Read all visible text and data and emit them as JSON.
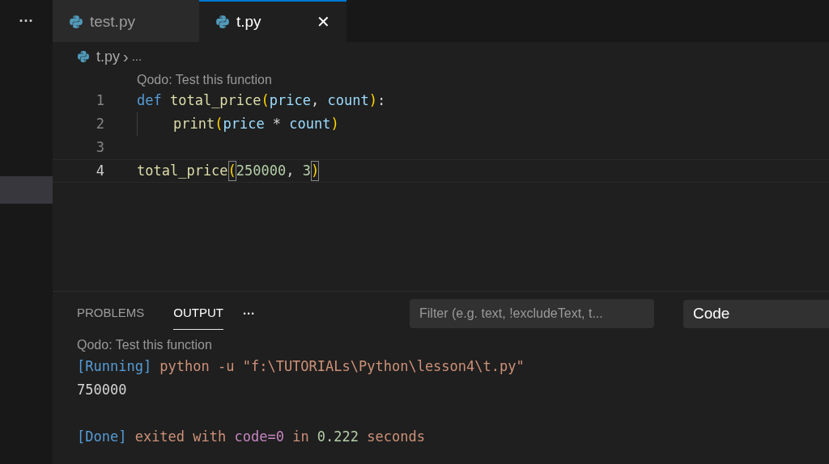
{
  "sidebar": {
    "more": "···",
    "rows": [
      {
        "selected": true
      }
    ]
  },
  "tabs": [
    {
      "label": "test.py",
      "selected": false
    },
    {
      "label": "t.py",
      "selected": true,
      "close": "✕"
    }
  ],
  "breadcrumb": {
    "file": "t.py",
    "separator": "›",
    "rest": "..."
  },
  "editor": {
    "codelens": "Qodo: Test this function",
    "lines": [
      {
        "number": "1",
        "active": false,
        "tokens": [
          {
            "text": "def ",
            "kind": "keyword"
          },
          {
            "text": "total_price",
            "kind": "function"
          },
          {
            "text": "(",
            "kind": "bracket"
          },
          {
            "text": "price",
            "kind": "param"
          },
          {
            "text": ", ",
            "kind": "plain"
          },
          {
            "text": "count",
            "kind": "param"
          },
          {
            "text": ")",
            "kind": "bracket"
          },
          {
            "text": ":",
            "kind": "plain"
          }
        ]
      },
      {
        "number": "2",
        "active": false,
        "tokens": [
          {
            "kind": "indent_guide"
          },
          {
            "text": "print",
            "kind": "function"
          },
          {
            "text": "(",
            "kind": "bracket"
          },
          {
            "text": "price",
            "kind": "param"
          },
          {
            "text": " * ",
            "kind": "plain"
          },
          {
            "text": "count",
            "kind": "param"
          },
          {
            "text": ")",
            "kind": "bracket"
          }
        ]
      },
      {
        "number": "3",
        "active": false
      },
      {
        "number": "4",
        "active": true,
        "tokens": [
          {
            "text": "total_price",
            "kind": "function"
          },
          {
            "text": "(",
            "kind": "bracket_match"
          },
          {
            "text": "250000",
            "kind": "number"
          },
          {
            "text": ", ",
            "kind": "plain"
          },
          {
            "text": "3",
            "kind": "number"
          },
          {
            "text": ")",
            "kind": "bracket_match"
          }
        ]
      }
    ]
  },
  "panel": {
    "tabs": [
      {
        "label": "PROBLEMS",
        "selected": false
      },
      {
        "label": "OUTPUT",
        "selected": true
      }
    ],
    "more": "···",
    "filter": {
      "placeholder": "Filter (e.g. text, !excludeText, t..."
    },
    "channel": {
      "value": "Code"
    },
    "codelens": "Qodo: Test this function",
    "output": [
      {
        "kind": "text",
        "tokens": [
          {
            "text": "[Running]",
            "kind": "tag"
          },
          {
            "text": " python -u \"f:\\TUTORIALs\\Python\\lesson4\\t.py\"",
            "kind": "string"
          }
        ]
      },
      {
        "kind": "text",
        "tokens": [
          {
            "text": "750000",
            "kind": "plain"
          }
        ]
      },
      {
        "kind": "blank"
      },
      {
        "kind": "text",
        "tokens": [
          {
            "text": "[Done]",
            "kind": "tag"
          },
          {
            "text": " exited with ",
            "kind": "string"
          },
          {
            "text": "code=0",
            "kind": "code"
          },
          {
            "text": " in ",
            "kind": "string"
          },
          {
            "text": "0.222",
            "kind": "number"
          },
          {
            "text": " seconds",
            "kind": "string"
          }
        ]
      }
    ]
  }
}
